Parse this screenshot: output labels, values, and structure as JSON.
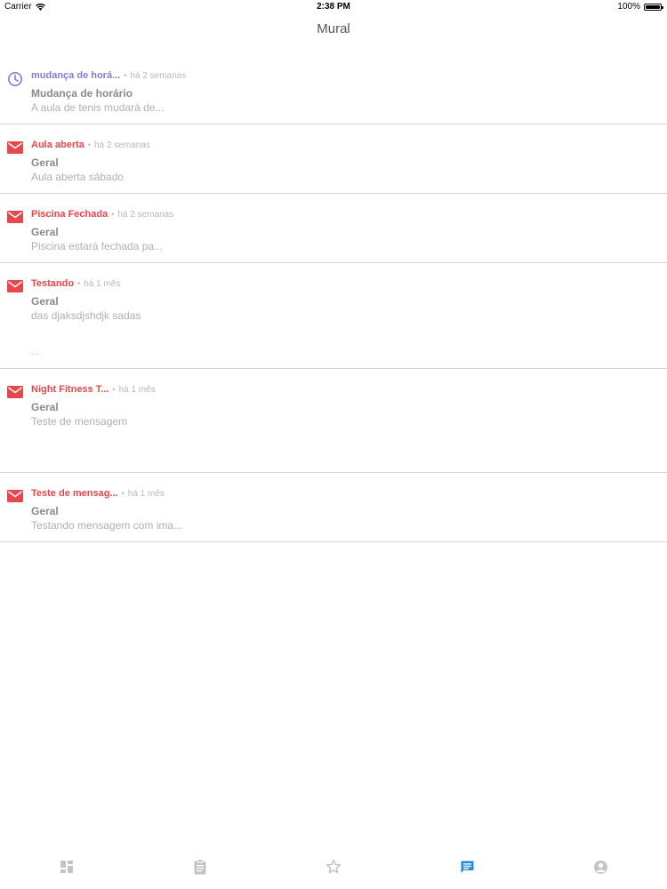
{
  "status_bar": {
    "carrier": "Carrier",
    "time": "2:38 PM",
    "battery": "100%",
    "battery_level": 1.0
  },
  "navbar": {
    "title": "Mural"
  },
  "colors": {
    "notice_accent": "#7f7fd0",
    "message_accent": "#e5484d",
    "tab_active": "#2b8ad8",
    "tab_inactive": "#c4c4c4"
  },
  "messages": [
    {
      "icon": "clock-icon",
      "title": "mudança de horá...",
      "separator": "•",
      "time": "há 2 semanas",
      "category": "Mudança de horário",
      "preview": "A aula de tenis mudará de...",
      "extra": ""
    },
    {
      "icon": "mail-icon",
      "title": "Aula aberta",
      "separator": "•",
      "time": "há 2 semanas",
      "category": "Geral",
      "preview": "Aula aberta sábado",
      "extra": ""
    },
    {
      "icon": "mail-icon",
      "title": "Piscina Fechada",
      "separator": "•",
      "time": "há 2 semanas",
      "category": "Geral",
      "preview": "Piscina estará fechada pa...",
      "extra": ""
    },
    {
      "icon": "mail-icon",
      "title": "Testando",
      "separator": "•",
      "time": "há 1 mês",
      "category": "Geral",
      "preview": "das djaksdjshdjk sadas",
      "extra": "..."
    },
    {
      "icon": "mail-icon",
      "title": "Night Fitness T...",
      "separator": "•",
      "time": "há 1 mês",
      "category": "Geral",
      "preview": "Teste de mensagem",
      "extra": ""
    },
    {
      "icon": "mail-icon",
      "title": "Teste de mensag...",
      "separator": "•",
      "time": "há 1 mês",
      "category": "Geral",
      "preview": "Testando mensagem com ima...",
      "extra": ""
    }
  ],
  "tab_bar": {
    "tabs": [
      {
        "icon": "dashboard-icon",
        "active": false
      },
      {
        "icon": "clipboard-icon",
        "active": false
      },
      {
        "icon": "star-icon",
        "active": false
      },
      {
        "icon": "chat-icon",
        "active": true
      },
      {
        "icon": "account-icon",
        "active": false
      }
    ]
  }
}
